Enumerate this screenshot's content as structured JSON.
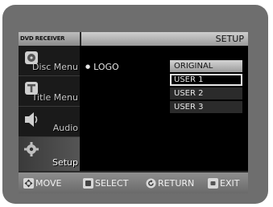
{
  "header": {
    "brand": "DVD RECEIVER",
    "title": "SETUP"
  },
  "sidebar": {
    "items": [
      {
        "label": "Disc Menu",
        "icon": "disc-icon",
        "active": false
      },
      {
        "label": "Title Menu",
        "icon": "title-icon",
        "active": false
      },
      {
        "label": "Audio",
        "icon": "speaker-icon",
        "active": false
      },
      {
        "label": "Setup",
        "icon": "gear-icon",
        "active": true
      }
    ]
  },
  "content": {
    "option_label": "LOGO",
    "options": [
      {
        "label": "ORIGINAL",
        "selected": false
      },
      {
        "label": "USER 1",
        "selected": true
      },
      {
        "label": "USER 2",
        "selected": false
      },
      {
        "label": "USER 3",
        "selected": false
      }
    ]
  },
  "footer": {
    "move": "MOVE",
    "select": "SELECT",
    "return": "RETURN",
    "exit": "EXIT"
  }
}
